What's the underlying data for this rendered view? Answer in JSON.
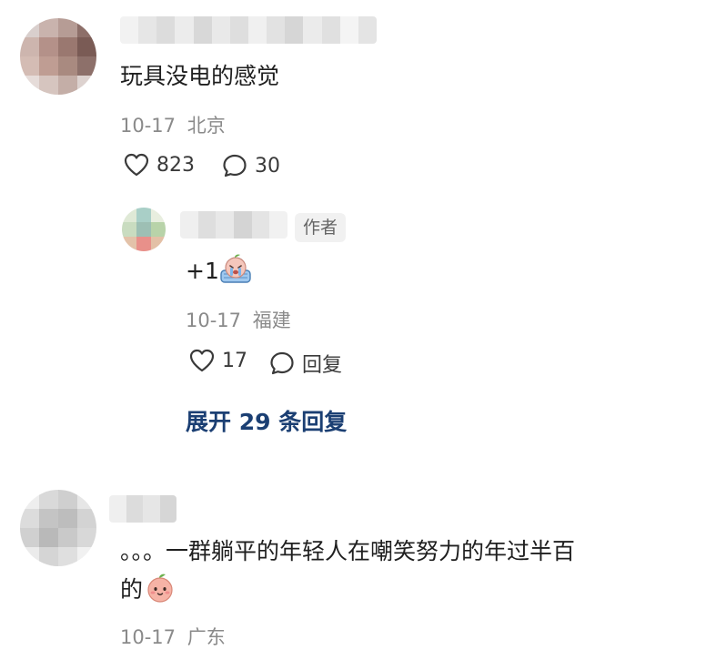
{
  "comments": [
    {
      "text": "玩具没电的感觉",
      "date": "10-17",
      "location": "北京",
      "like_count": "823",
      "reply_count": "30"
    },
    {
      "text_prefix": "+1",
      "author_badge": "作者",
      "date": "10-17",
      "location": "福建",
      "like_count": "17",
      "reply_label": "回复"
    },
    {
      "text_line1": "。。。一群躺平的年轻人在嘲笑努力的年过半百",
      "text_line2": "的",
      "date": "10-17",
      "location": "广东"
    }
  ],
  "expand_replies_label": "展开 29 条回复",
  "icons": {
    "like": "heart-outline-icon",
    "comment": "speech-bubble-icon",
    "reply_emoji": "crying-peach-emoji",
    "smile_emoji": "smiling-peach-emoji"
  },
  "colors": {
    "link": "#1b3f73",
    "meta": "#8a8a8a",
    "text": "#1f1f1f"
  }
}
